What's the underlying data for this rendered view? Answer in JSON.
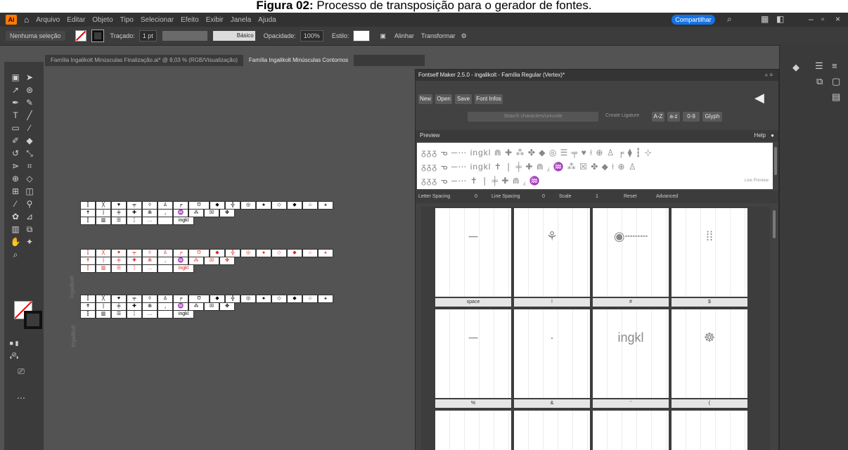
{
  "caption": {
    "bold": "Figura 02:",
    "rest": " Processo de transposição para o gerador de fontes."
  },
  "app": {
    "logo": "Ai"
  },
  "menubar": {
    "items": [
      "Arquivo",
      "Editar",
      "Objeto",
      "Tipo",
      "Selecionar",
      "Efeito",
      "Exibir",
      "Janela",
      "Ajuda"
    ],
    "share_label": "Compartilhar"
  },
  "controlbar": {
    "selection_label": "Nenhuma seleção",
    "stroke_label": "Traçado:",
    "stroke_value": "1 pt",
    "stroke_style": "Básico",
    "opacity_label": "Opacidade:",
    "opacity_value": "100%",
    "style_label": "Estilo:",
    "align_label": "Alinhar",
    "transform_label": "Transformar"
  },
  "tabs": [
    {
      "label": "Família Ingalikolt Minúsculas Finalização.ai* @ 8,03 % (RGB/Visualização)",
      "active": false
    },
    {
      "label": "Família Ingalikolt Minúsculas Contornos",
      "active": true
    }
  ],
  "glyph_rows": [
    {
      "row1": [
        "┇",
        "╳",
        "♥",
        "╤",
        "◊",
        "♙",
        "╒",
        "Ʊ",
        "◆",
        "╬",
        "◎",
        "♠",
        "◇",
        "◆",
        "♧",
        "⚹"
      ],
      "row2": [
        "✝",
        "❘",
        "╪",
        "✚",
        "⋒",
        "⁁",
        "♒",
        "⁂",
        "☒",
        "✤"
      ],
      "row3": [
        "┇",
        "▥",
        "☰",
        "╎",
        "…",
        "",
        "ingkl"
      ],
      "red": false
    },
    {
      "row1": [
        "┇",
        "╳",
        "♥",
        "╤",
        "◊",
        "♙",
        "╒",
        "Ʊ",
        "◆",
        "╬",
        "◎",
        "♠",
        "◇",
        "◆",
        "♧",
        "⚹"
      ],
      "row2": [
        "✝",
        "❘",
        "╪",
        "✚",
        "⋒",
        "⁁",
        "♒",
        "⁂",
        "☒",
        "✤"
      ],
      "row3": [
        "┇",
        "▥",
        "☰",
        "╎",
        "…",
        "",
        "ingkl"
      ],
      "red": true
    },
    {
      "row1": [
        "┇",
        "╳",
        "♥",
        "╤",
        "◊",
        "♙",
        "╒",
        "Ʊ",
        "◆",
        "╬",
        "◎",
        "♠",
        "◇",
        "◆",
        "♧",
        "⚹"
      ],
      "row2": [
        "✝",
        "❘",
        "╪",
        "✚",
        "⋒",
        "⁁",
        "♒",
        "⁂",
        "☒",
        "✤"
      ],
      "row3": [
        "┇",
        "▥",
        "☰",
        "╎",
        "…",
        "",
        "ingkl"
      ],
      "red": false
    }
  ],
  "side_labels": [
    "Ingalikolt",
    "Ingalikolt"
  ],
  "panel": {
    "title": "Fontself Maker 2.5.0 - ingalikolt - Família Regular (Vertex)*",
    "buttons": [
      "New",
      "Open",
      "Save",
      "Font Infos"
    ],
    "unicode_placeholder": "Search characters/unicode",
    "create_ligature": "Create Ligature",
    "case_buttons": [
      "A-Z",
      "a-z",
      "0-9",
      "Glyph"
    ],
    "preview_label": "Preview",
    "help_label": "Help",
    "preview_lines": [
      "ᵹᵹᵹ ᓀ ─⋯  ingkl ⋒ ✚ ⁂ ✤ ◆ ◎ ☰ ╤ ♥ ⍿ ⊕ ♙ ╒ ⧫ ┇ ⊹",
      "ᵹᵹᵹ ᓀ ─⋯ ingkl ✝ ❘ ╪ ✚ ⋒ ⁁ ♒ ⁂ ☒ ✤ ◆ ⍿ ⊕ ♙",
      "ᵹᵹᵹ ᓀ ─⋯ ✝ ❘ ╪ ✚ ⋒ ⁁ ♒"
    ],
    "live_preview": "Live Preview",
    "spacing": {
      "letter_label": "Letter Spacing",
      "letter_value": "0",
      "line_label": "Line Spacing",
      "line_value": "0",
      "scale_label": "Scale",
      "scale_value": "1",
      "reset_label": "Reset",
      "advanced_label": "Advanced"
    },
    "glyph_cards": [
      {
        "glyph": "─",
        "label": "space"
      },
      {
        "glyph": "⚘",
        "label": "!"
      },
      {
        "glyph": "◉┄┄┄",
        "label": "#"
      },
      {
        "glyph": "⁞⁞",
        "label": "$"
      },
      {
        "glyph": "─",
        "label": "%"
      },
      {
        "glyph": "·",
        "label": "&"
      },
      {
        "glyph": "ingkl",
        "label": "'"
      },
      {
        "glyph": "☸",
        "label": "("
      }
    ]
  },
  "colors": {
    "app_bg": "#535353",
    "menubar": "#323232",
    "share": "#1473e6",
    "panel": "#424242",
    "red_glyph": "#dd2222"
  }
}
